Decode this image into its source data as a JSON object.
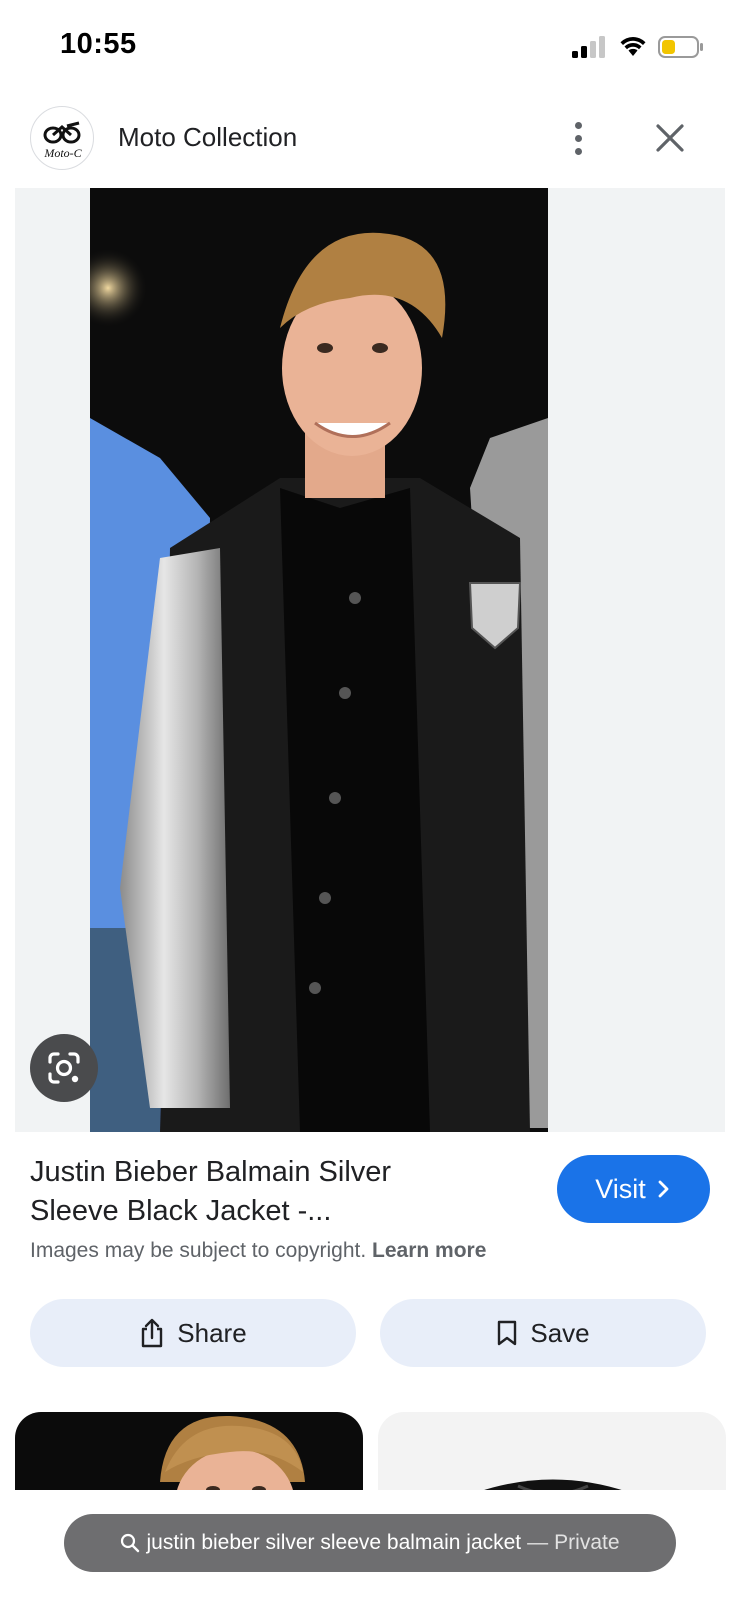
{
  "status_bar": {
    "time": "10:55",
    "icons": [
      "cellular-signal-icon",
      "wifi-icon",
      "battery-icon"
    ]
  },
  "header": {
    "site_name": "Moto Collection",
    "logo_text": "Moto-C",
    "more_icon": "more-vert-icon",
    "close_icon": "close-icon"
  },
  "image": {
    "lens_icon": "google-lens-icon"
  },
  "result": {
    "title_line1": "Justin Bieber Balmain Silver",
    "title_line2": "Sleeve Black Jacket -...",
    "visit_label": "Visit",
    "copyright_text": "Images may be subject to copyright.",
    "learn_more": "Learn more"
  },
  "actions": {
    "share_label": "Share",
    "save_label": "Save"
  },
  "search": {
    "query": "justin bieber silver sleeve balmain jacket",
    "separator": "—",
    "mode": "Private"
  },
  "colors": {
    "accent": "#1a73e8",
    "action_bg": "#e8eef9",
    "pill_bg": "#6e6e70",
    "battery_low": "#f2c500"
  }
}
